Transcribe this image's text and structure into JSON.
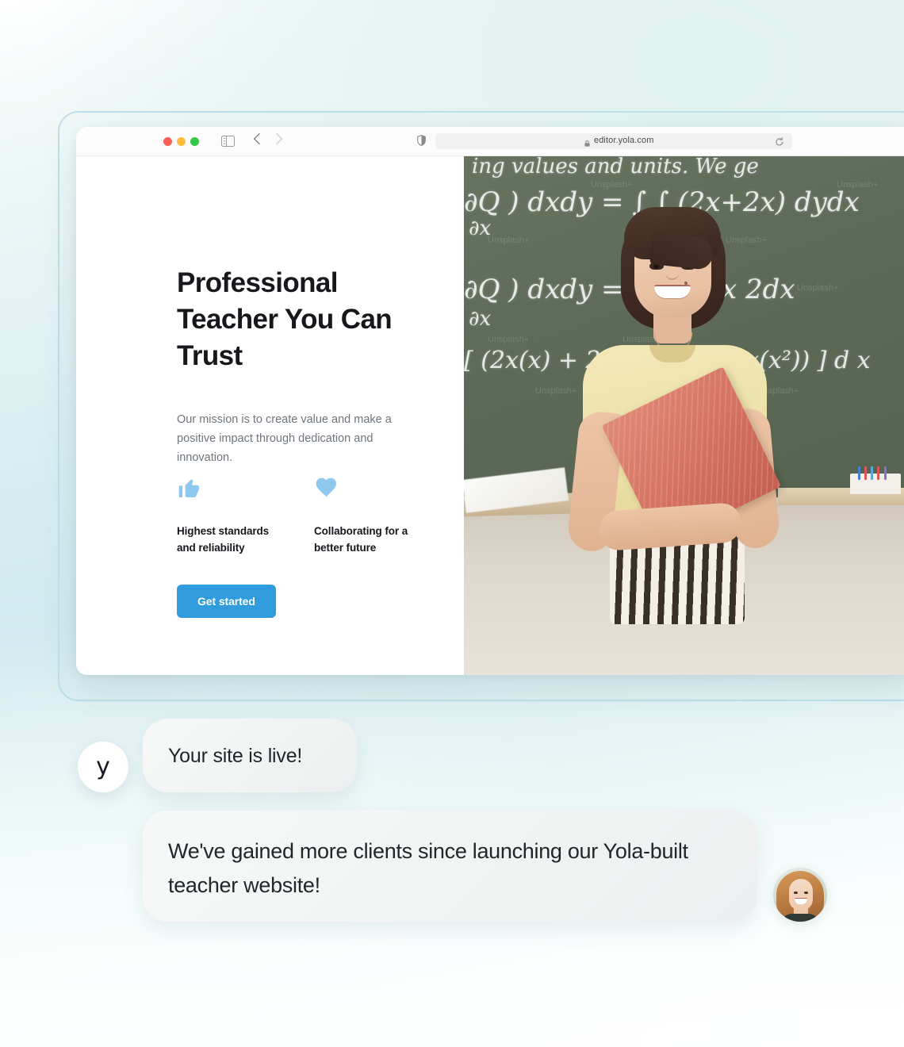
{
  "browser": {
    "traffic_lights": [
      "close",
      "minimize",
      "maximize"
    ],
    "sidebar_toggle_label": "sidebar-toggle",
    "back_label": "Back",
    "forward_label": "Forward",
    "shield_label": "Privacy Report",
    "url": "editor.yola.com",
    "reload_label": "Reload",
    "lock_label": "Secure connection"
  },
  "hero": {
    "title": "Professional Teacher You Can Trust",
    "subtitle": "Our mission is to create value and make a positive impact through dedication and innovation.",
    "features": [
      {
        "icon": "thumbs-up-icon",
        "label": "Highest standards and reliability"
      },
      {
        "icon": "heart-icon",
        "label": "Collaborating for a better future"
      }
    ],
    "cta_label": "Get started",
    "accent_color": "#309bdd",
    "feature_icon_color": "#8ec8ee",
    "photo_alt": "Teacher holding a red book in front of a chalkboard"
  },
  "chalkboard": {
    "lines": [
      "ing values and units. We ge",
      "∂Q  ) dxdy = ∫ ∫ (2x+2x) dydx",
      "∂x",
      "∂Q  ) dxdy = ∫        2xy ]x 2dx",
      "∂x",
      "[ (2x(x) + 2x(x)) - (2     +2x(x²)) ] d x"
    ],
    "watermark": "Unsplash+"
  },
  "chat": {
    "yola_logo": "y",
    "messages": [
      {
        "name": "status-message",
        "text": "Your site is live!"
      },
      {
        "name": "testimonial-message",
        "text": "We've gained more clients since launching our Yola-built teacher website!"
      }
    ],
    "client_avatar_alt": "Smiling client portrait"
  }
}
